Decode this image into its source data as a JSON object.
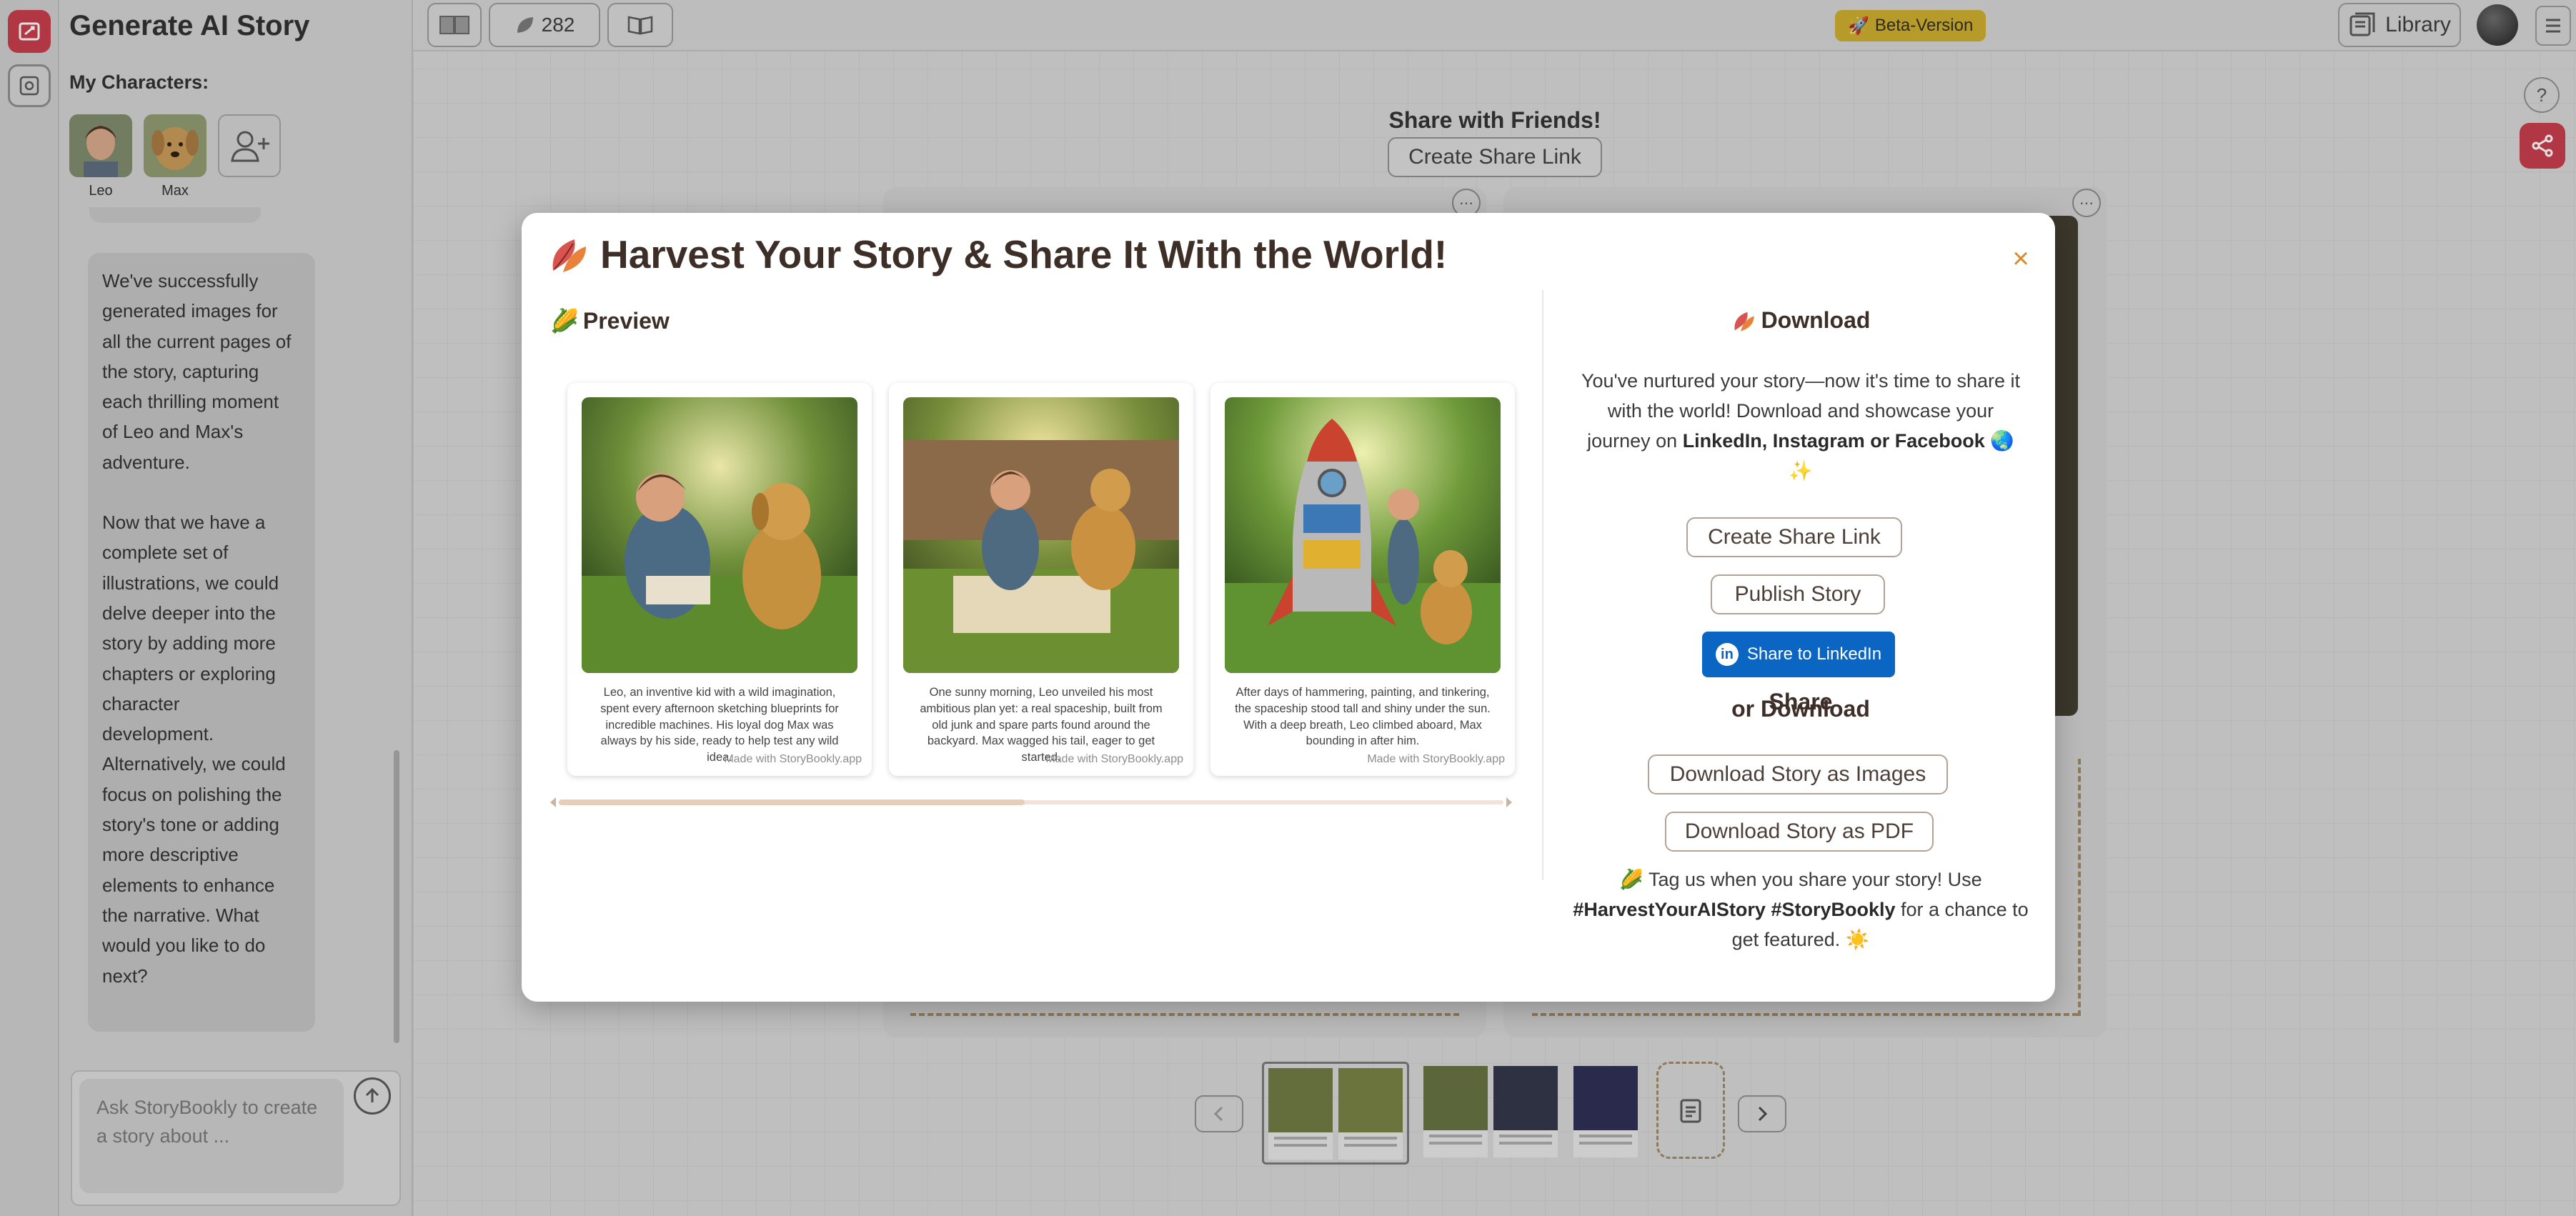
{
  "app": {
    "title": "Generate AI Story"
  },
  "sidebar": {
    "characters_label": "My Characters:",
    "characters": [
      {
        "name": "Leo"
      },
      {
        "name": "Max"
      }
    ],
    "chat_paragraph_1": "We've successfully\ngenerated images for\nall the current pages of\nthe story, capturing\neach thrilling moment\nof Leo and Max's\nadventure.",
    "chat_paragraph_2": "Now that we have a\ncomplete set of\nillustrations, we could\ndelve deeper into the\nstory by adding more\nchapters or exploring\ncharacter\ndevelopment.\nAlternatively, we could\nfocus on polishing the\nstory's tone or adding\nmore descriptive\nelements to enhance\nthe narrative. What\nwould you like to do\nnext?",
    "composer_placeholder": "Ask StoryBookly to create\na story about ..."
  },
  "topbar": {
    "credits": "282",
    "beta_label": "Beta-Version",
    "library_label": "Library"
  },
  "canvas": {
    "share_title": "Share with Friends!",
    "share_button": "Create Share Link",
    "help_label": "?"
  },
  "modal": {
    "title": "Harvest Your Story & Share It With the World!",
    "close_label": "×",
    "preview_label": "Preview",
    "pages": [
      {
        "text": "Leo, an inventive kid with a wild imagination, spent every afternoon sketching blueprints for incredible machines. His loyal dog Max was always by his side, ready to help test any wild idea.",
        "credit": "Made with StoryBookly.app"
      },
      {
        "text": "One sunny morning, Leo unveiled his most ambitious plan yet: a real spaceship, built from old junk and spare parts found around the backyard. Max wagged his tail, eager to get started.",
        "credit": "Made with StoryBookly.app"
      },
      {
        "text": "After days of hammering, painting, and tinkering, the spaceship stood tall and shiny under the sun. With a deep breath, Leo climbed aboard, Max bounding in after him.",
        "credit": "Made with StoryBookly.app"
      }
    ],
    "download": {
      "heading": "Download",
      "desc_pre": "You've nurtured your story—now it's time to share it with the world! Download and showcase your journey on ",
      "desc_bold": "LinkedIn, Instagram or Facebook",
      "desc_post": " 🌏 ✨",
      "share_label": "Share",
      "create_link": "Create Share Link",
      "publish": "Publish Story",
      "linkedin": "Share to LinkedIn",
      "or_download": "or Download",
      "as_images": "Download Story as Images",
      "as_pdf": "Download Story as PDF",
      "tag_pre": "🌽 Tag us when you share your story! Use ",
      "tag_bold": "#HarvestYourAIStory #StoryBookly",
      "tag_post": " for a chance to get featured. ☀️"
    }
  },
  "colors": {
    "accent_red": "#c93a4a",
    "linkedin_blue": "#0a66c2",
    "close_orange": "#d98a2c",
    "beta_yellow": "#cfae2a"
  },
  "icons": [
    "logo-icon",
    "settings-icon",
    "add-character-icon",
    "send-icon",
    "book-icon",
    "leaf-icon",
    "open-book-icon",
    "rocket-icon",
    "library-icon",
    "menu-icon",
    "share-icon",
    "leaf-logo-icon",
    "corn-icon",
    "linkedin-icon",
    "chevron-left-icon",
    "chevron-right-icon",
    "add-page-icon"
  ]
}
